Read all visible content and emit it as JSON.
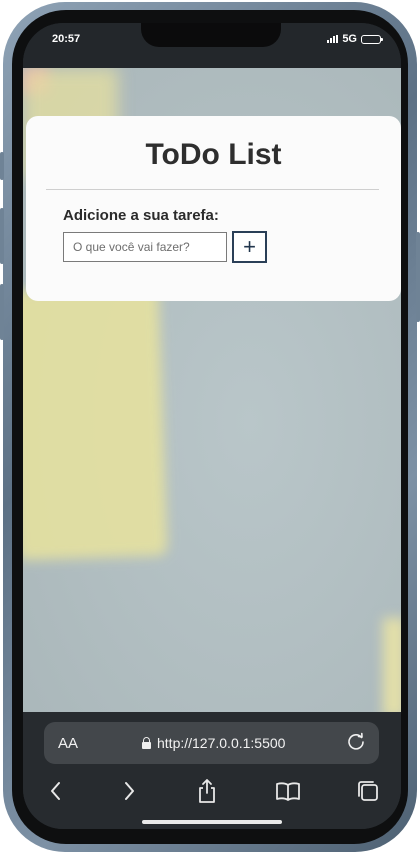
{
  "status_bar": {
    "time": "20:57",
    "network": "5G"
  },
  "app": {
    "title": "ToDo List",
    "add_label": "Adicione a sua tarefa:",
    "input_placeholder": "O que você vai fazer?",
    "input_value": "",
    "add_button_label": "+",
    "colors": {
      "card_background": "#fbfbfb",
      "button_border": "#2a3f57",
      "title_text": "#2e2e2e"
    }
  },
  "browser": {
    "text_size_label": "AA",
    "url": "http://127.0.0.1:5500",
    "icons": [
      "lock-icon",
      "reload-icon",
      "back-icon",
      "forward-icon",
      "share-icon",
      "bookmarks-icon",
      "tabs-icon"
    ]
  }
}
